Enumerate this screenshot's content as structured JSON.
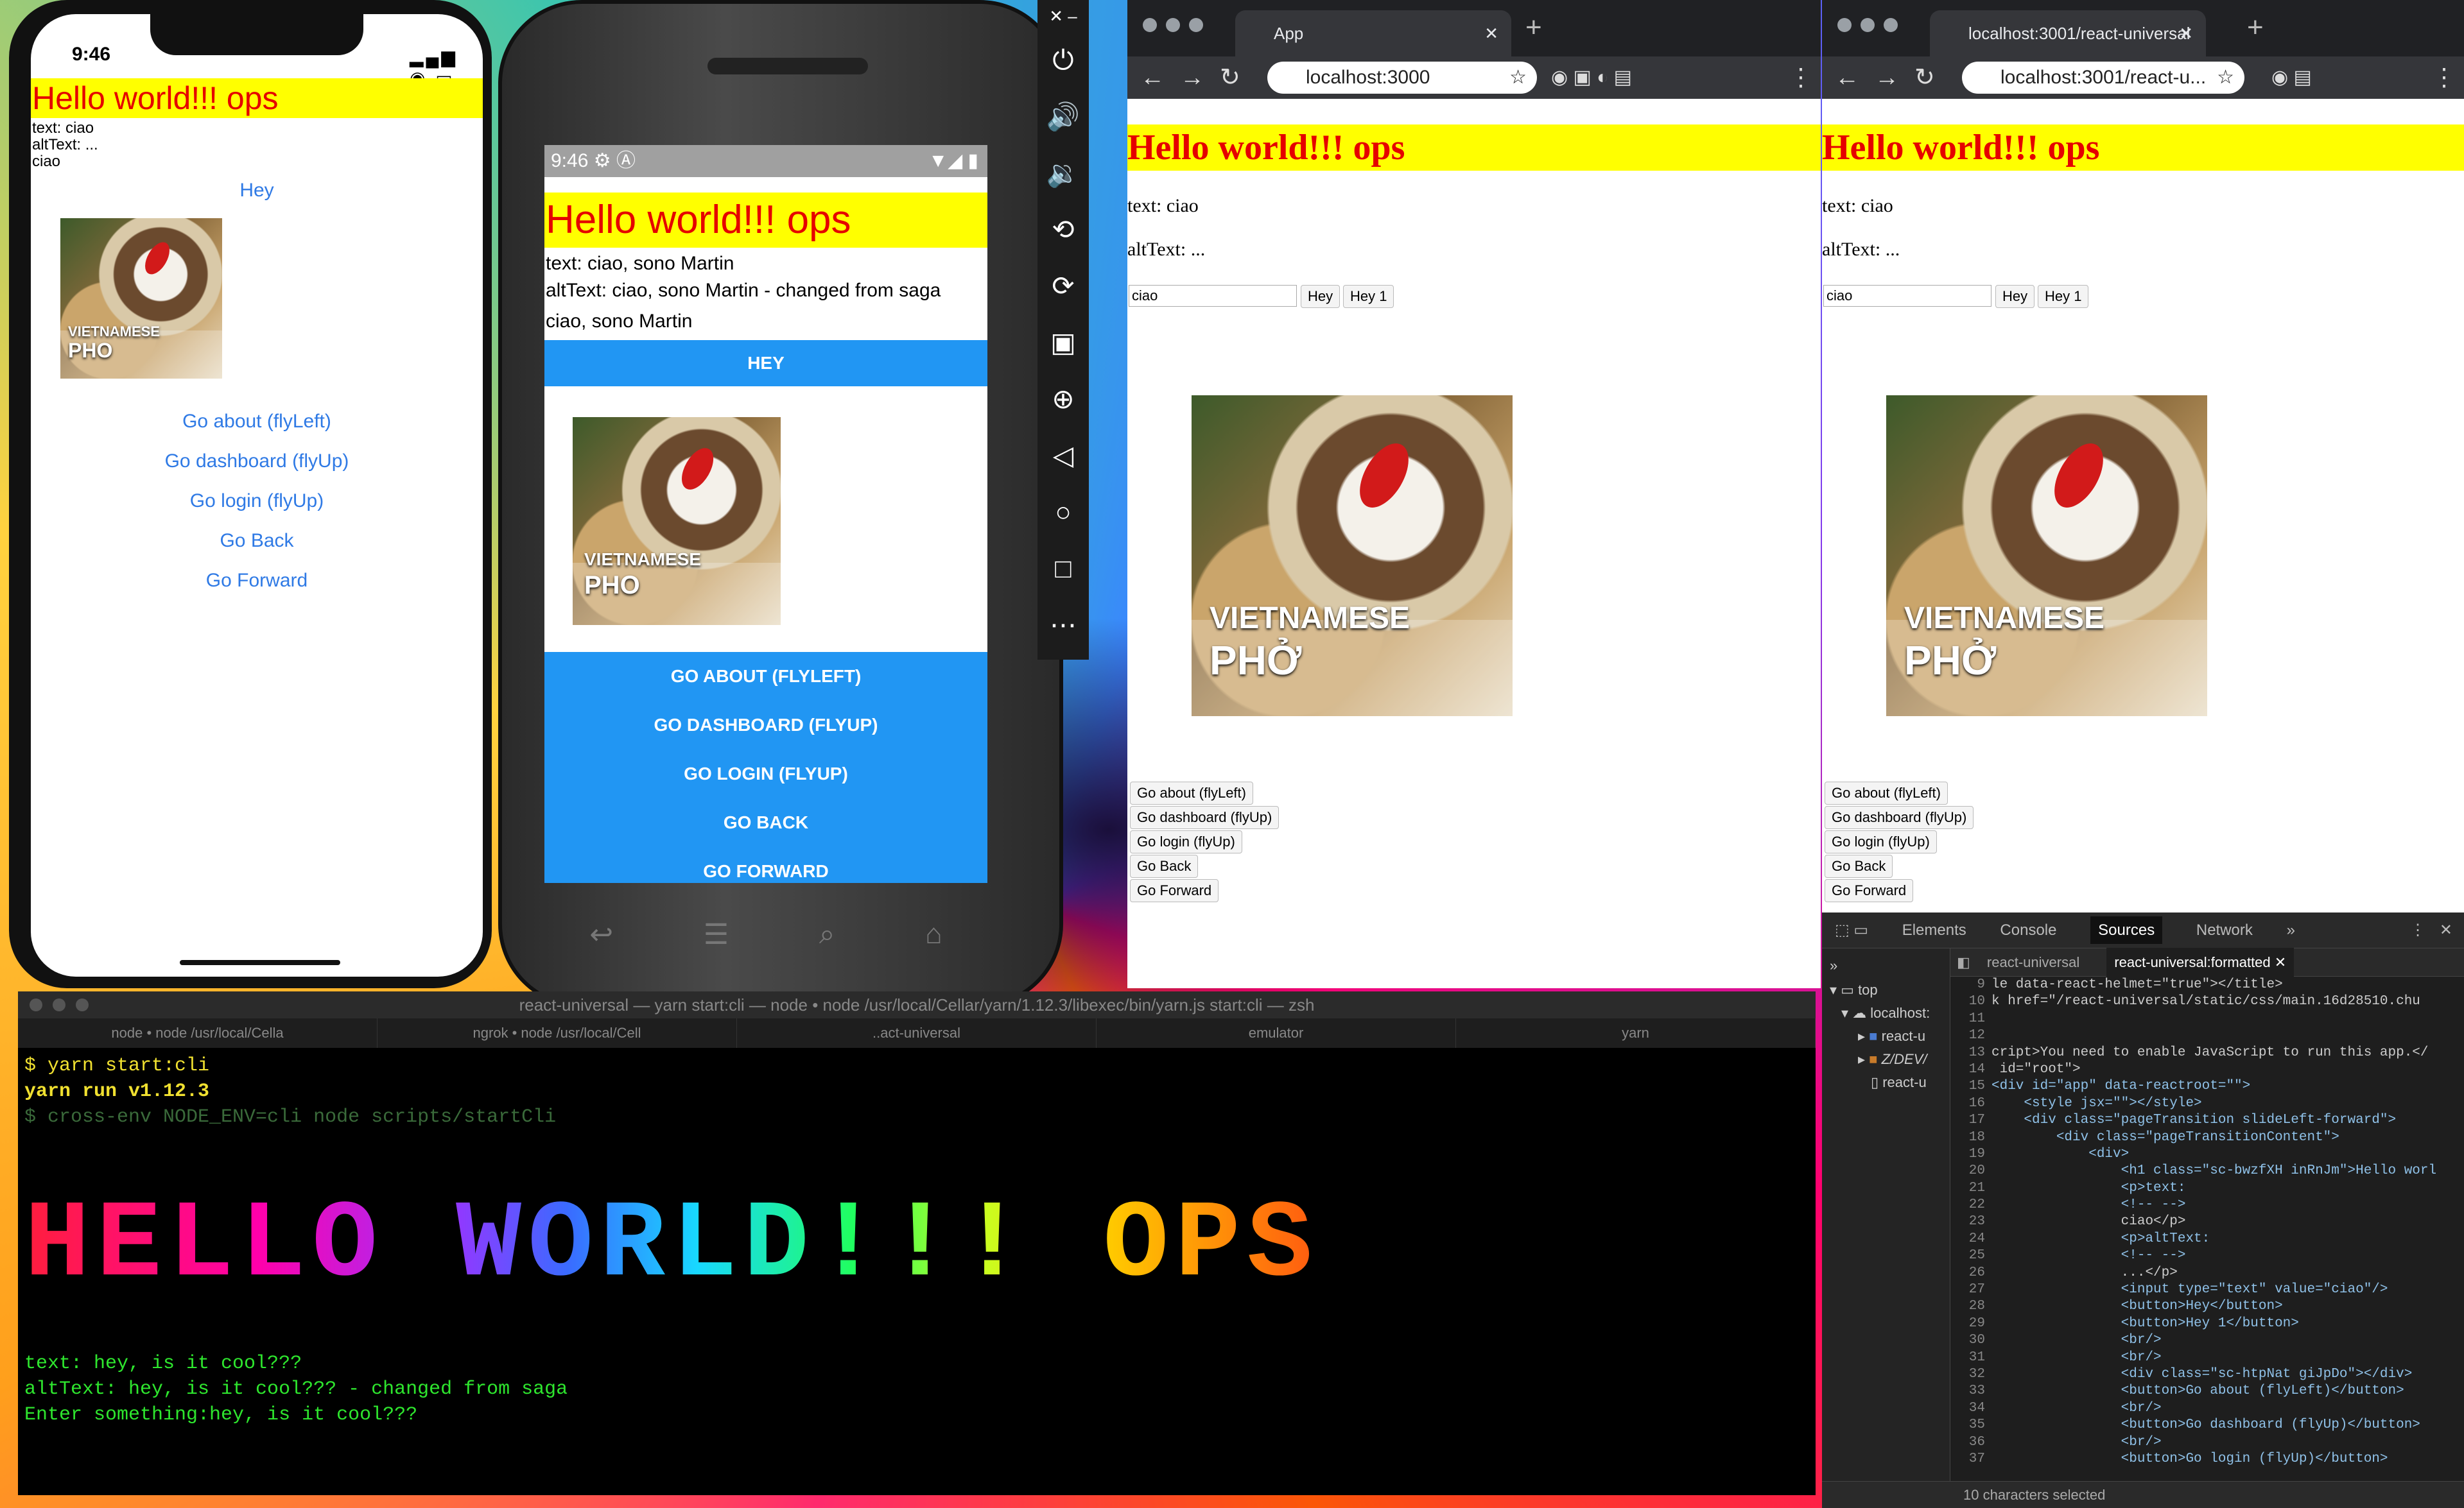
{
  "iphone": {
    "time": "9:46",
    "title": "Hello world!!! ops",
    "text_line": "text: ciao",
    "alt_line": "altText: ...",
    "value_line": "ciao",
    "hey_button": "Hey",
    "image_label_top": "VIETNAMESE",
    "image_label_bottom": "PHO",
    "links": [
      "Go about (flyLeft)",
      "Go dashboard (flyUp)",
      "Go login (flyUp)",
      "Go Back",
      "Go Forward"
    ]
  },
  "android": {
    "time": "9:46",
    "title": "Hello world!!! ops",
    "text_line": "text: ciao, sono Martin",
    "alt_line": "altText: ciao, sono Martin - changed from saga",
    "value_line": "ciao, sono Martin",
    "hey_button": "HEY",
    "image_label_top": "VIETNAMESE",
    "image_label_bottom": "PHO",
    "buttons": [
      "GO ABOUT (FLYLEFT)",
      "GO DASHBOARD (FLYUP)",
      "GO LOGIN (FLYUP)",
      "GO BACK",
      "GO FORWARD"
    ]
  },
  "browser1": {
    "tab_title": "App",
    "url": "localhost:3000",
    "title": "Hello world!!! ops",
    "text_line": "text: ciao",
    "alt_line": "altText: ...",
    "input_value": "ciao",
    "hey_button": "Hey",
    "hey1_button": "Hey 1",
    "image_label_top": "VIETNAMESE",
    "image_label_bottom": "PHỞ",
    "buttons": [
      "Go about (flyLeft)",
      "Go dashboard (flyUp)",
      "Go login (flyUp)",
      "Go Back",
      "Go Forward"
    ]
  },
  "browser2": {
    "tab_title": "localhost:3001/react-universal",
    "url": "localhost:3001/react-u...",
    "title": "Hello world!!! ops",
    "text_line": "text: ciao",
    "alt_line": "altText: ...",
    "input_value": "ciao",
    "hey_button": "Hey",
    "hey1_button": "Hey 1",
    "image_label_top": "VIETNAMESE",
    "image_label_bottom": "PHỞ",
    "buttons": [
      "Go about (flyLeft)",
      "Go dashboard (flyUp)",
      "Go login (flyUp)",
      "Go Back",
      "Go Forward"
    ]
  },
  "devtools": {
    "tabs": [
      "Elements",
      "Console",
      "Sources",
      "Network"
    ],
    "active_tab": "Sources",
    "file_tabs": [
      "react-universal",
      "react-universal:formatted"
    ],
    "tree": [
      "top",
      "localhost:",
      "react-u",
      "Z/DEV/",
      "react-u"
    ],
    "code_lines": [
      {
        "n": "9",
        "t": "le data-react-helmet=\"true\"></title>"
      },
      {
        "n": "10",
        "t": "k href=\"/react-universal/static/css/main.16d28510.chu"
      },
      {
        "n": "11",
        "t": ""
      },
      {
        "n": "12",
        "t": ""
      },
      {
        "n": "13",
        "t": "cript>You need to enable JavaScript to run this app.</"
      },
      {
        "n": "14",
        "t": " id=\"root\">"
      },
      {
        "n": "15",
        "t": "<div id=\"app\" data-reactroot=\"\">"
      },
      {
        "n": "16",
        "t": "    <style jsx=\"\"></style>"
      },
      {
        "n": "17",
        "t": "    <div class=\"pageTransition slideLeft-forward\">"
      },
      {
        "n": "18",
        "t": "        <div class=\"pageTransitionContent\">"
      },
      {
        "n": "19",
        "t": "            <div>"
      },
      {
        "n": "20",
        "t": "                <h1 class=\"sc-bwzfXH inRnJm\">Hello worl"
      },
      {
        "n": "21",
        "t": "                <p>text:"
      },
      {
        "n": "22",
        "t": "                <!-- -->"
      },
      {
        "n": "23",
        "t": "                ciao</p>"
      },
      {
        "n": "24",
        "t": "                <p>altText:"
      },
      {
        "n": "25",
        "t": "                <!-- -->"
      },
      {
        "n": "26",
        "t": "                ...</p>"
      },
      {
        "n": "27",
        "t": "                <input type=\"text\" value=\"ciao\"/>"
      },
      {
        "n": "28",
        "t": "                <button>Hey</button>"
      },
      {
        "n": "29",
        "t": "                <button>Hey 1</button>"
      },
      {
        "n": "30",
        "t": "                <br/>"
      },
      {
        "n": "31",
        "t": "                <br/>"
      },
      {
        "n": "32",
        "t": "                <div class=\"sc-htpNat giJpDo\"></div>"
      },
      {
        "n": "33",
        "t": "                <button>Go about (flyLeft)</button>"
      },
      {
        "n": "34",
        "t": "                <br/>"
      },
      {
        "n": "35",
        "t": "                <button>Go dashboard (flyUp)</button>"
      },
      {
        "n": "36",
        "t": "                <br/>"
      },
      {
        "n": "37",
        "t": "                <button>Go login (flyUp)</button>"
      }
    ],
    "footer": "10 characters selected"
  },
  "terminal": {
    "title": "react-universal — yarn start:cli — node • node /usr/local/Cellar/yarn/1.12.3/libexec/bin/yarn.js start:cli — zsh",
    "tabs": [
      "node • node /usr/local/Cella",
      "ngrok • node /usr/local/Cell",
      "..act-universal",
      "emulator",
      "yarn"
    ],
    "cmd1": "$ yarn start:cli",
    "cmd2": "yarn run v1.12.3",
    "cmd3": "$ cross-env NODE_ENV=cli node scripts/startCli",
    "banner": "HELLO WORLD!!! OPS",
    "out1": "text: hey, is it cool???",
    "out2": "altText: hey, is it cool??? - changed from saga",
    "out3": "Enter something:hey, is it cool???"
  }
}
